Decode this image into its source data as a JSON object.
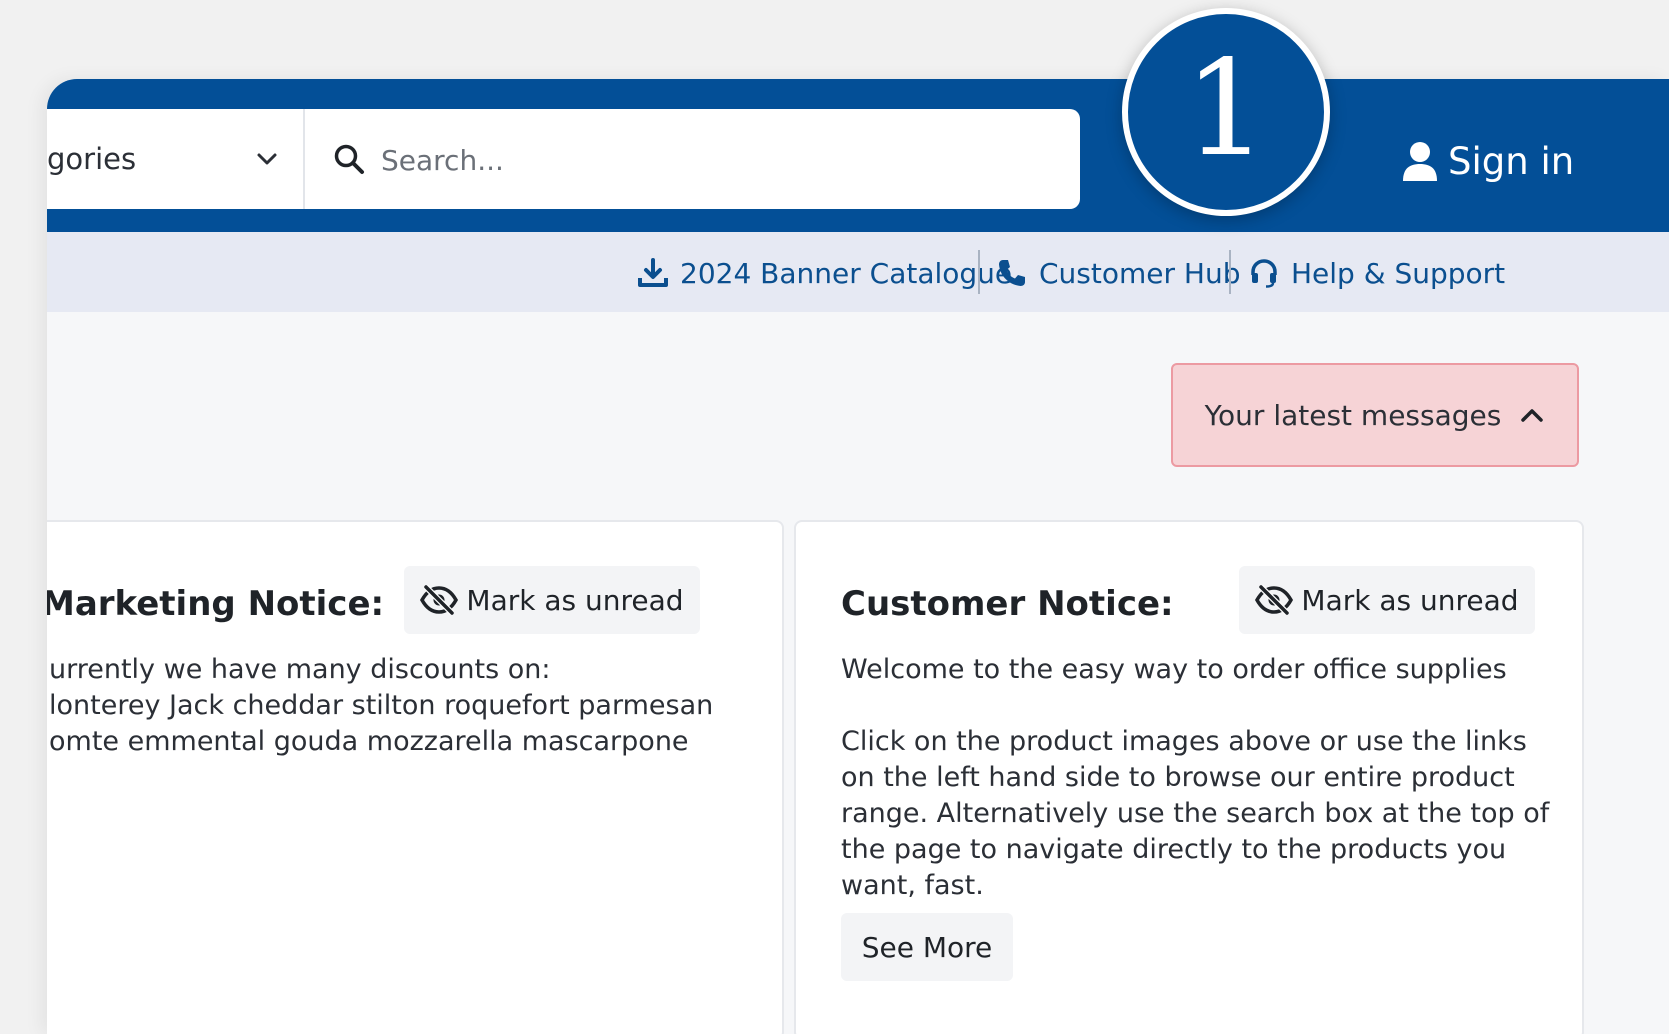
{
  "header": {
    "category_select_text": "gories",
    "search_placeholder": "Search...",
    "sign_in_label": "Sign in"
  },
  "subnav": {
    "links": [
      {
        "label": "2024 Banner Catalogue",
        "icon": "download-icon"
      },
      {
        "label": "Customer Hub",
        "icon": "phone-icon"
      },
      {
        "label": "Help & Support",
        "icon": "headset-icon"
      }
    ]
  },
  "messages": {
    "toggle_label": "Your latest messages",
    "cards": [
      {
        "title": "Marketing Notice:",
        "mark_label": "Mark as unread",
        "body": "urrently we have many discounts on:\nlonterey Jack cheddar stilton roquefort parmesan\nomte emmental gouda mozzarella mascarpone"
      },
      {
        "title": "Customer Notice:",
        "mark_label": "Mark as unread",
        "body": "Welcome to the easy way to order office supplies\n\nClick on the product images above or use the links\non the left hand side to browse our entire product\nrange. Alternatively use the search box at the top of\nthe page to navigate directly to the products you\nwant, fast.",
        "see_more_label": "See More"
      }
    ]
  },
  "step_badge": {
    "number": "1"
  },
  "colors": {
    "brand_blue": "#034f97",
    "subbar_bg": "#e6e9f3",
    "link_blue": "#0b4f8f",
    "alert_bg": "#f6d3d6",
    "alert_border": "#ec9aa2"
  }
}
